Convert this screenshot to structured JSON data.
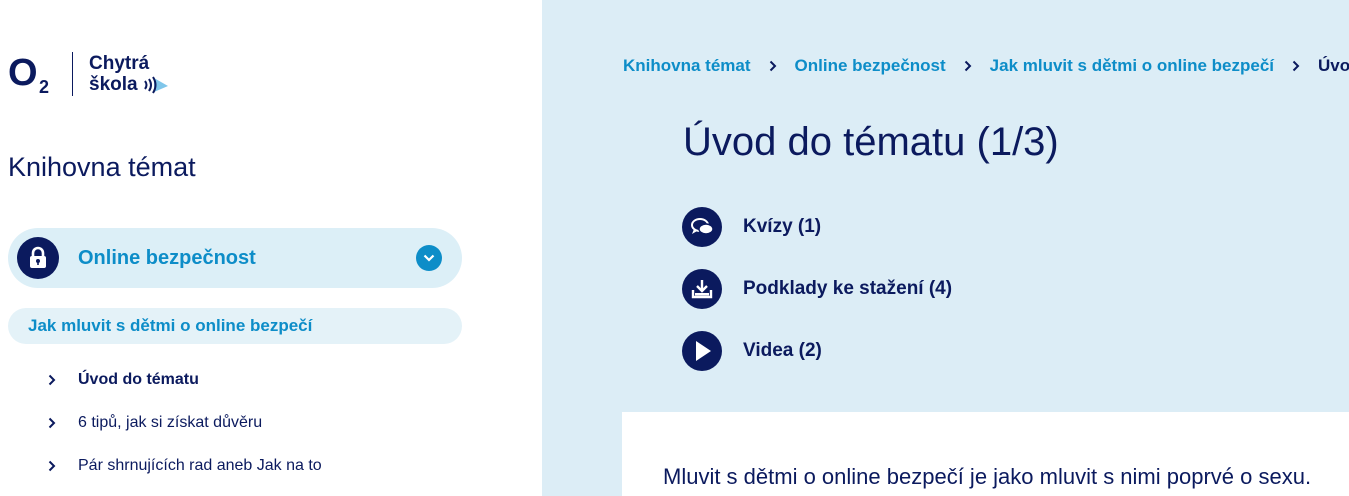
{
  "logo": {
    "brand": "O",
    "brand_sub": "2",
    "line1": "Chytrá",
    "line2": "škola"
  },
  "sidebar": {
    "title": "Knihovna témat",
    "topic": {
      "label": "Online bezpečnost",
      "icon": "lock-icon"
    },
    "subtopic": {
      "label": "Jak mluvit s dětmi o online bezpečí"
    },
    "items": [
      {
        "label": "Úvod do tématu",
        "active": true
      },
      {
        "label": "6 tipů, jak si získat důvěru",
        "active": false
      },
      {
        "label": "Pár shrnujících rad aneb Jak na to",
        "active": false
      }
    ]
  },
  "breadcrumb": {
    "items": [
      "Knihovna témat",
      "Online bezpečnost",
      "Jak mluvit s dětmi o online bezpečí"
    ],
    "current": "Úvo"
  },
  "content": {
    "title": "Úvod do tématu (1/3)",
    "resources": [
      {
        "label": "Kvízy (1)",
        "icon": "chat-bubbles-icon"
      },
      {
        "label": "Podklady ke stažení (4)",
        "icon": "download-icon"
      },
      {
        "label": "Videa (2)",
        "icon": "play-icon"
      }
    ],
    "intro_text": "Mluvit s dětmi o online bezpečí je jako mluvit s nimi poprvé o sexu."
  },
  "colors": {
    "navy": "#0b1a5e",
    "accent_blue": "#0d8dc8",
    "panel_bg": "#dcedf6",
    "pill_bg": "#dceff7"
  }
}
